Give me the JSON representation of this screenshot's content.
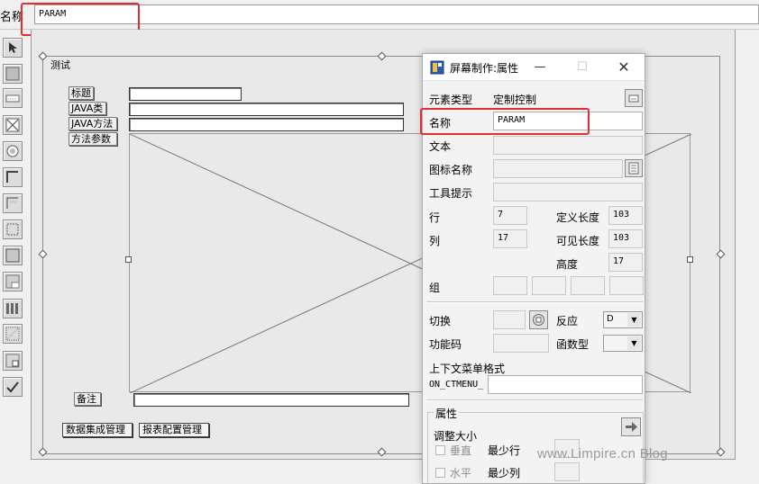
{
  "top_bar": {
    "label": "名称",
    "value": "PARAM"
  },
  "palette": {
    "tools": [
      "pointer-tool-icon",
      "solid-box-tool-icon",
      "label-tool-icon",
      "cross-box-tool-icon",
      "radio-tool-icon",
      "frame-tool-icon",
      "tabframe-tool-icon",
      "grid-tool-icon",
      "box-tool-icon",
      "subbox-tool-icon",
      "table-tool-icon",
      "dotted-box-tool-icon",
      "custom-control-tool-icon",
      "check-tool-icon"
    ]
  },
  "form": {
    "group_title": "测试",
    "fields": [
      {
        "label": "标题"
      },
      {
        "label": "JAVA类"
      },
      {
        "label": "JAVA方法"
      },
      {
        "label": "方法参数"
      }
    ],
    "remark_label": "备注",
    "buttons": [
      "数据集成管理",
      "报表配置管理"
    ]
  },
  "dialog": {
    "title": "屏幕制作:属性",
    "element_type_label": "元素类型",
    "element_type_value": "定制控制",
    "name_label": "名称",
    "name_value": "PARAM",
    "text_label": "文本",
    "text_value": "",
    "icon_name_label": "图标名称",
    "icon_name_value": "",
    "tooltip_label": "工具提示",
    "tooltip_value": "",
    "row_label": "行",
    "row_value": "7",
    "col_label": "列",
    "col_value": "17",
    "def_len_label": "定义长度",
    "def_len_value": "103",
    "vis_len_label": "可见长度",
    "vis_len_value": "103",
    "height_label": "高度",
    "height_value": "17",
    "group_label": "组",
    "switch_label": "切换",
    "response_label": "反应",
    "response_value": "D",
    "func_code_label": "功能码",
    "func_type_label": "函数型",
    "ctx_menu_label": "上下文菜单格式",
    "ctx_menu_prefix": "ON_CTMENU_",
    "attr_group_label": "属性",
    "resize_label": "调整大小",
    "vertical_label": "垂直",
    "min_rows_label": "最少行",
    "horizontal_label": "水平",
    "min_cols_label": "最少列"
  },
  "watermark": "www.Limpire.cn Blog",
  "colors": {
    "highlight": "#e03030",
    "window_bg": "#f0f0f0",
    "dialog_bg": "#f3f3f3"
  }
}
